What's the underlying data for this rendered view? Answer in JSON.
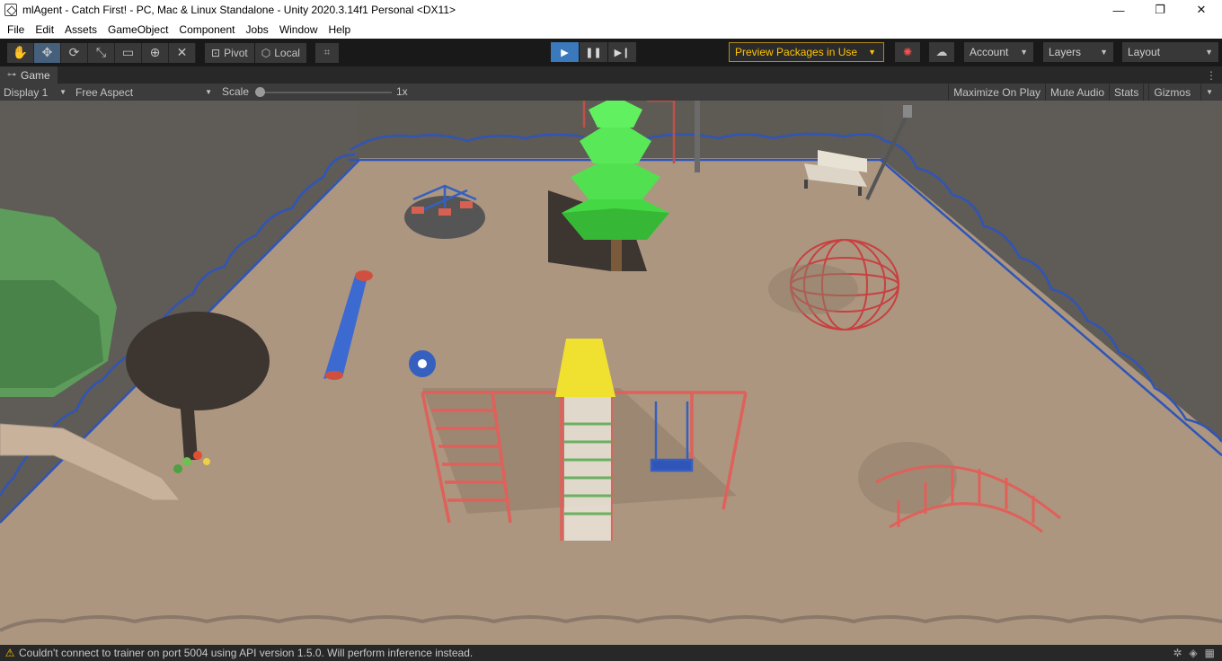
{
  "window": {
    "title": "mlAgent - Catch First! - PC, Mac & Linux Standalone - Unity 2020.3.14f1 Personal <DX11>",
    "controls": [
      "minimize-icon",
      "maximize-icon",
      "close-icon"
    ]
  },
  "menu": {
    "items": [
      "File",
      "Edit",
      "Assets",
      "GameObject",
      "Component",
      "Jobs",
      "Window",
      "Help"
    ]
  },
  "toolbar": {
    "tools": [
      {
        "name": "hand-tool-icon",
        "glyph": "✋"
      },
      {
        "name": "move-tool-icon",
        "glyph": "✥"
      },
      {
        "name": "rotate-tool-icon",
        "glyph": "⟳"
      },
      {
        "name": "scale-tool-icon",
        "glyph": "⤡"
      },
      {
        "name": "rect-tool-icon",
        "glyph": "▭"
      },
      {
        "name": "transform-tool-icon",
        "glyph": "⊕"
      },
      {
        "name": "custom-tool-icon",
        "glyph": "✕"
      }
    ],
    "pivot_label": "Pivot",
    "local_label": "Local",
    "preview_packages_label": "Preview Packages in Use",
    "account_label": "Account",
    "layers_label": "Layers",
    "layout_label": "Layout"
  },
  "game_tab": {
    "label": "Game"
  },
  "game_bar": {
    "display": "Display 1",
    "aspect": "Free Aspect",
    "scale_label": "Scale",
    "scale_value": "1x",
    "maximize_on_play": "Maximize On Play",
    "mute_audio": "Mute Audio",
    "stats": "Stats",
    "gizmos": "Gizmos"
  },
  "status": {
    "message": "Couldn't connect to trainer on port 5004 using API version 1.5.0. Will perform inference instead."
  },
  "colors": {
    "accent_play": "#3a79bb",
    "warning": "#ffc400",
    "ground": "#ac9680",
    "fence": "#2f55b8"
  }
}
